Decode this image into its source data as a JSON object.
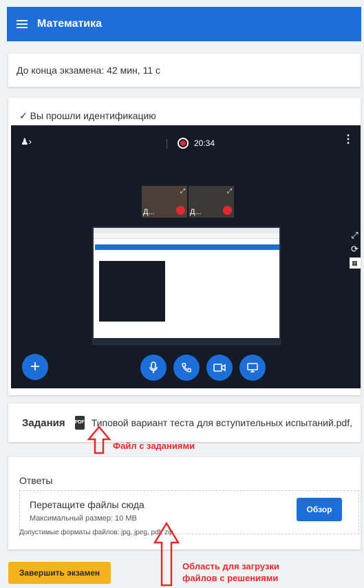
{
  "header": {
    "title": "Математика"
  },
  "timer": {
    "text": "До конца экзамена: 42 мин, 11 с"
  },
  "identification": {
    "status": "✓ Вы прошли идентификацию",
    "video": {
      "time": "20:34",
      "participants": [
        "Д...",
        "Д..."
      ]
    }
  },
  "tasks": {
    "label": "Задания",
    "file_name": "Типовой вариант теста для вступительных испытаний.pdf,"
  },
  "answers": {
    "title": "Ответы",
    "drop_title": "Перетащите файлы сюда",
    "max_size": "Максимальный размер: 10 MB",
    "browse_button": "Обзор",
    "formats": "Допустимые форматы файлов: jpg, jpeg, pdf, zip"
  },
  "finish_button": "Завершить экзамен",
  "annotations": {
    "tasks_file": "Файл с заданиями",
    "upload_area_line1": "Область для загрузки",
    "upload_area_line2": "файлов с решениями"
  },
  "colors": {
    "brand": "#1e6ed9",
    "finish": "#f5b21c",
    "annotation": "#e8282a"
  }
}
